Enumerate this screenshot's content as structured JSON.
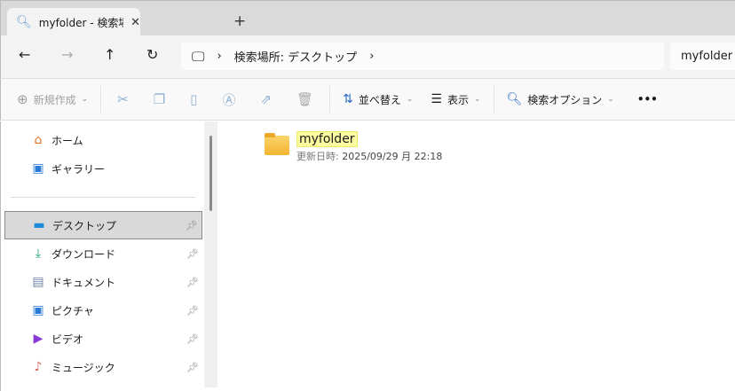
{
  "tab": {
    "title": "myfolder - 検索場所: デスクトップ",
    "close": "✕",
    "new": "+"
  },
  "nav": {
    "back": "←",
    "forward": "→",
    "up": "↑",
    "refresh": "↻",
    "sep1": "›",
    "location": "検索場所: デスクトップ",
    "sep2": "›",
    "search_value": "myfolder"
  },
  "toolbar": {
    "new": "新規作成",
    "sort": "並べ替え",
    "view": "表示",
    "search_options": "検索オプション",
    "more": "•••"
  },
  "sidebar": {
    "items": [
      {
        "label": "ホーム",
        "icon": "home-icon"
      },
      {
        "label": "ギャラリー",
        "icon": "gallery-icon"
      },
      {
        "label": "デスクトップ",
        "icon": "desktop-icon",
        "pinned": true,
        "selected": true
      },
      {
        "label": "ダウンロード",
        "icon": "download-icon",
        "pinned": true
      },
      {
        "label": "ドキュメント",
        "icon": "documents-icon",
        "pinned": true
      },
      {
        "label": "ピクチャ",
        "icon": "pictures-icon",
        "pinned": true
      },
      {
        "label": "ビデオ",
        "icon": "videos-icon",
        "pinned": true
      },
      {
        "label": "ミュージック",
        "icon": "music-icon",
        "pinned": true
      }
    ]
  },
  "results": [
    {
      "name": "myfolder",
      "modified_label": "更新日時:",
      "modified": "2025/09/29 月 22:18"
    }
  ]
}
